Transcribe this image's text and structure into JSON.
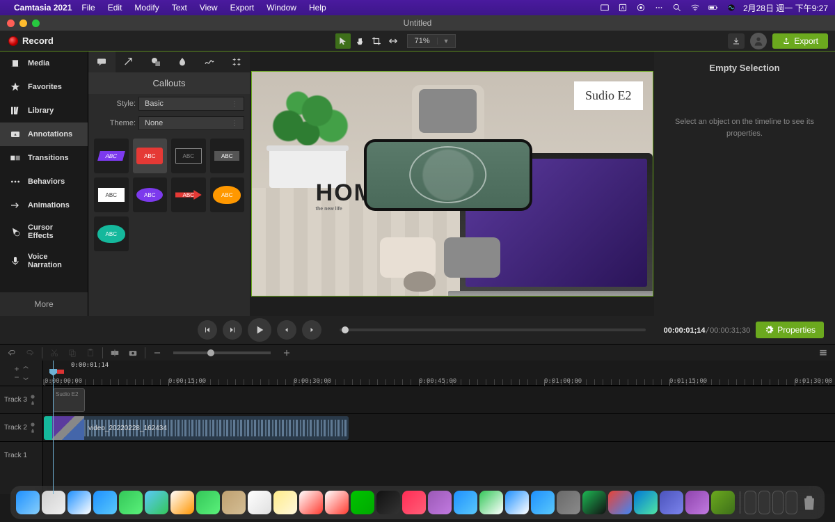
{
  "menubar": {
    "app_name": "Camtasia 2021",
    "items": [
      "File",
      "Edit",
      "Modify",
      "Text",
      "View",
      "Export",
      "Window",
      "Help"
    ],
    "date": "2月28日 週一 下午9:27"
  },
  "window": {
    "title": "Untitled"
  },
  "toolbar": {
    "record_label": "Record",
    "zoom": "71%",
    "export_label": "Export"
  },
  "rail": {
    "items": [
      {
        "label": "Media",
        "icon": "media"
      },
      {
        "label": "Favorites",
        "icon": "star"
      },
      {
        "label": "Library",
        "icon": "library"
      },
      {
        "label": "Annotations",
        "icon": "annotations"
      },
      {
        "label": "Transitions",
        "icon": "transitions"
      },
      {
        "label": "Behaviors",
        "icon": "behaviors"
      },
      {
        "label": "Animations",
        "icon": "animations"
      },
      {
        "label": "Cursor Effects",
        "icon": "cursor"
      },
      {
        "label": "Voice Narration",
        "icon": "mic"
      }
    ],
    "more": "More",
    "active_index": 3
  },
  "assets": {
    "header": "Callouts",
    "style_label": "Style:",
    "style_value": "Basic",
    "theme_label": "Theme:",
    "theme_value": "None",
    "callouts": [
      "ABC",
      "ABC",
      "ABC",
      "ABC",
      "ABC",
      "ABC",
      "ABC",
      "ABC",
      "ABC"
    ]
  },
  "canvas": {
    "overlay_label": "Sudio E2",
    "home_text": "HOM",
    "home_sub": "the new life"
  },
  "properties": {
    "title": "Empty Selection",
    "hint": "Select an object on the timeline to see its properties.",
    "button": "Properties"
  },
  "playback": {
    "current": "00:00:01;14",
    "total": "00:00:31;30"
  },
  "timeline": {
    "position": "0:00:01;14",
    "ruler": [
      "0:00:00;00",
      "0:00:15;00",
      "0:00:30;00",
      "0:00:45;00",
      "0:01:00;00",
      "0:01:15;00",
      "0:01:30;00"
    ],
    "tracks": [
      "Track 3",
      "Track 2",
      "Track 1"
    ],
    "text_clip_label": "Sudio E2",
    "video_clip_label": "video_20220228_162434"
  },
  "dock_apps": [
    {
      "name": "finder",
      "c1": "#1e90ff",
      "c2": "#87cefa"
    },
    {
      "name": "launchpad",
      "c1": "#d0d0d0",
      "c2": "#efefef"
    },
    {
      "name": "safari",
      "c1": "#1e90ff",
      "c2": "#fff"
    },
    {
      "name": "mail",
      "c1": "#1e90ff",
      "c2": "#5ac8fa"
    },
    {
      "name": "messages",
      "c1": "#34c759",
      "c2": "#5af07a"
    },
    {
      "name": "maps",
      "c1": "#5ac8fa",
      "c2": "#34c759"
    },
    {
      "name": "photos",
      "c1": "#fff",
      "c2": "#ff9500"
    },
    {
      "name": "facetime",
      "c1": "#34c759",
      "c2": "#5af07a"
    },
    {
      "name": "contacts",
      "c1": "#bfa070",
      "c2": "#d4be95"
    },
    {
      "name": "reminders",
      "c1": "#fff",
      "c2": "#e0e0e0"
    },
    {
      "name": "notes",
      "c1": "#ffec8b",
      "c2": "#fff8dc"
    },
    {
      "name": "calendar1",
      "c1": "#fff",
      "c2": "#ff3b30"
    },
    {
      "name": "calendar2",
      "c1": "#fff",
      "c2": "#ff3b30"
    },
    {
      "name": "line",
      "c1": "#00c300",
      "c2": "#0a0"
    },
    {
      "name": "tv",
      "c1": "#111",
      "c2": "#333"
    },
    {
      "name": "music",
      "c1": "#ff2d55",
      "c2": "#ff5e78"
    },
    {
      "name": "podcasts",
      "c1": "#9b59b6",
      "c2": "#c17ae0"
    },
    {
      "name": "appstore",
      "c1": "#1e90ff",
      "c2": "#5ac8fa"
    },
    {
      "name": "numbers",
      "c1": "#34c759",
      "c2": "#fff"
    },
    {
      "name": "keynote",
      "c1": "#1e90ff",
      "c2": "#fff"
    },
    {
      "name": "appstore2",
      "c1": "#1e90ff",
      "c2": "#5ac8fa"
    },
    {
      "name": "settings",
      "c1": "#6a6a6a",
      "c2": "#8a8a8a"
    },
    {
      "name": "spotify",
      "c1": "#1db954",
      "c2": "#111"
    },
    {
      "name": "chrome",
      "c1": "#ea4335",
      "c2": "#4285f4"
    },
    {
      "name": "edge",
      "c1": "#0078d7",
      "c2": "#50e6a4"
    },
    {
      "name": "teams",
      "c1": "#4b53bc",
      "c2": "#7b83eb"
    },
    {
      "name": "player",
      "c1": "#8e44ad",
      "c2": "#c17ae0"
    },
    {
      "name": "camtasia",
      "c1": "#6ba91e",
      "c2": "#3e6f1a"
    }
  ]
}
